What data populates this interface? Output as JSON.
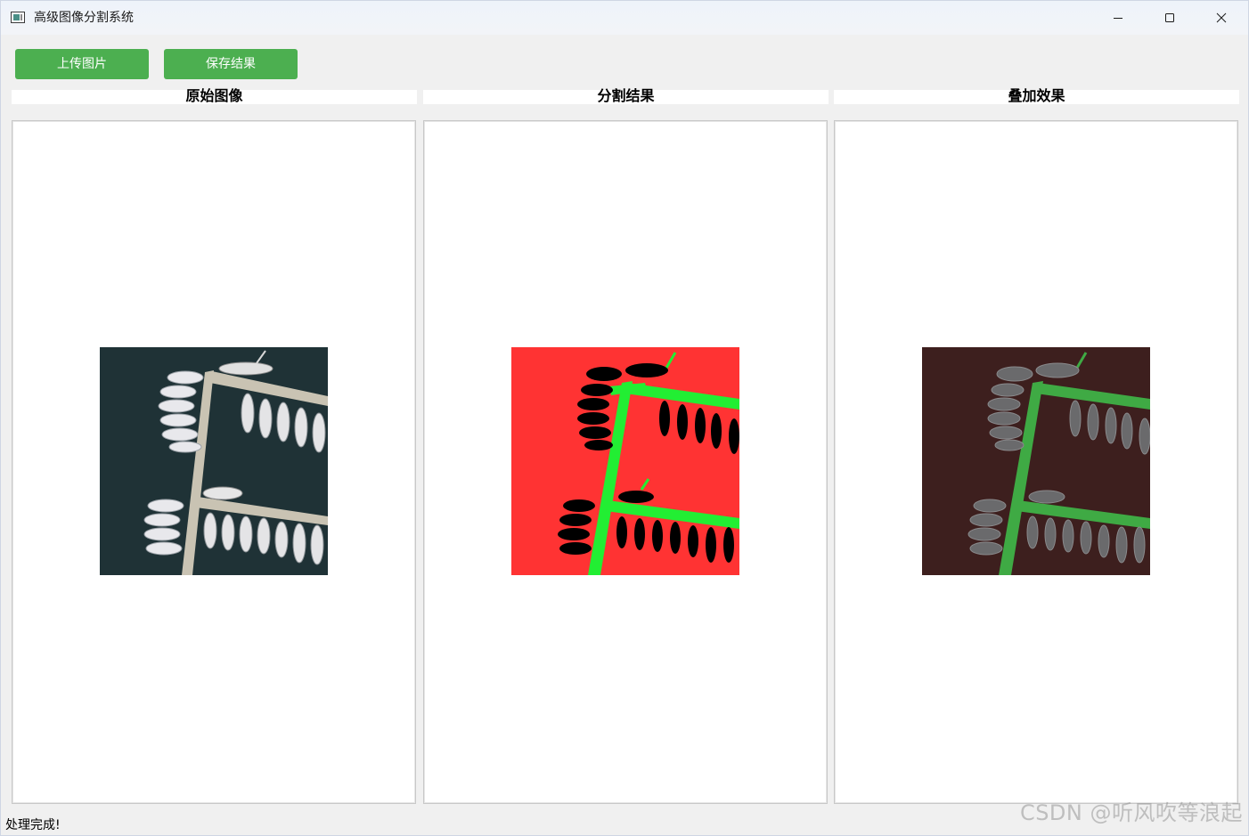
{
  "window": {
    "title": "高级图像分割系统"
  },
  "toolbar": {
    "upload_label": "上传图片",
    "save_label": "保存结果"
  },
  "panels": [
    {
      "header": "原始图像"
    },
    {
      "header": "分割结果"
    },
    {
      "header": "叠加效果"
    }
  ],
  "status": {
    "message": "处理完成!"
  },
  "watermark": "CSDN @听风吹等浪起",
  "colors": {
    "button_bg": "#4caf50",
    "seg_background": "#ff3333",
    "seg_dock": "#22ee33",
    "seg_boat": "#000000",
    "water": "#1f3236",
    "overlay_tint": "#3d1f1e"
  }
}
